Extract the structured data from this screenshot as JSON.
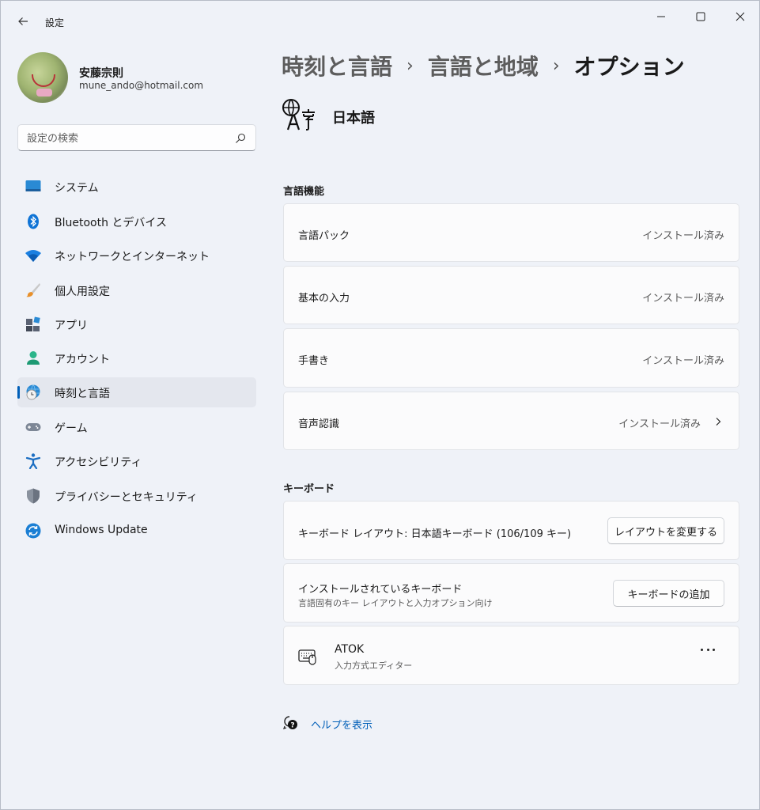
{
  "window": {
    "app_title": "設定",
    "back_icon": "back-arrow-icon",
    "controls": [
      "minimize-icon",
      "maximize-icon",
      "close-icon"
    ]
  },
  "profile": {
    "name": "安藤宗則",
    "email": "mune_ando@hotmail.com"
  },
  "search": {
    "placeholder": "設定の検索",
    "value": ""
  },
  "sidebar": {
    "items": [
      {
        "label": "システム",
        "icon": "monitor-icon"
      },
      {
        "label": "Bluetooth とデバイス",
        "icon": "bluetooth-icon"
      },
      {
        "label": "ネットワークとインターネット",
        "icon": "wifi-icon"
      },
      {
        "label": "個人用設定",
        "icon": "paintbrush-icon"
      },
      {
        "label": "アプリ",
        "icon": "apps-icon"
      },
      {
        "label": "アカウント",
        "icon": "person-icon"
      },
      {
        "label": "時刻と言語",
        "icon": "globe-clock-icon",
        "selected": true
      },
      {
        "label": "ゲーム",
        "icon": "gamepad-icon"
      },
      {
        "label": "アクセシビリティ",
        "icon": "accessibility-icon"
      },
      {
        "label": "プライバシーとセキュリティ",
        "icon": "shield-icon"
      },
      {
        "label": "Windows Update",
        "icon": "update-icon"
      }
    ]
  },
  "breadcrumb": {
    "items": [
      "時刻と言語",
      "言語と地域",
      "オプション"
    ]
  },
  "language": {
    "name": "日本語",
    "icon": "language-icon"
  },
  "language_features": {
    "title": "言語機能",
    "items": [
      {
        "label": "言語パック",
        "status": "インストール済み"
      },
      {
        "label": "基本の入力",
        "status": "インストール済み"
      },
      {
        "label": "手書き",
        "status": "インストール済み"
      },
      {
        "label": "音声認識",
        "status": "インストール済み",
        "chevron": true
      }
    ]
  },
  "keyboard": {
    "title": "キーボード",
    "layout": {
      "label": "キーボード レイアウト: 日本語キーボード (106/109 キー)",
      "button": "レイアウトを変更する"
    },
    "installed": {
      "label": "インストールされているキーボード",
      "sub": "言語固有のキー レイアウトと入力オプション向け",
      "button": "キーボードの追加"
    },
    "ime": {
      "name": "ATOK",
      "sub": "入力方式エディター",
      "icon": "keyboard-icon"
    }
  },
  "help": {
    "label": "ヘルプを表示",
    "icon": "help-icon"
  },
  "colors": {
    "accent": "#005fb8",
    "background": "#eff2f8",
    "card": "#fbfbfc"
  }
}
